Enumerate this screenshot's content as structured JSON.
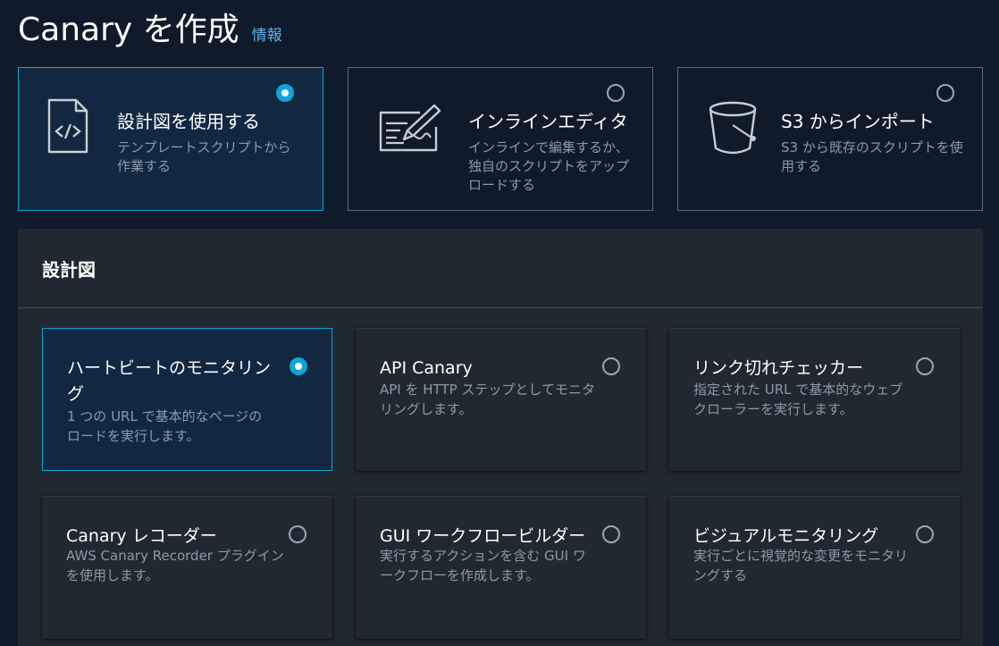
{
  "page": {
    "title": "Canary を作成",
    "info_link": "情報"
  },
  "methods": [
    {
      "title": "設計図を使用する",
      "desc": "テンプレートスクリプトから作業する",
      "selected": true,
      "icon": "code-file-icon"
    },
    {
      "title": "インラインエディタ",
      "desc": "インラインで編集するか、独自のスクリプトをアップロードする",
      "selected": false,
      "icon": "editor-pen-icon"
    },
    {
      "title": "S3 からインポート",
      "desc": "S3 から既存のスクリプトを使用する",
      "selected": false,
      "icon": "bucket-icon"
    }
  ],
  "blueprints": {
    "heading": "設計図",
    "items": [
      {
        "title": "ハートビートのモニタリング",
        "desc": "1 つの URL で基本的なページのロードを実行します。",
        "selected": true
      },
      {
        "title": "API Canary",
        "desc": "API を HTTP ステップとしてモニタリングします。",
        "selected": false
      },
      {
        "title": "リンク切れチェッカー",
        "desc": "指定された URL で基本的なウェブクローラーを実行します。",
        "selected": false
      },
      {
        "title": "Canary レコーダー",
        "desc": "AWS Canary Recorder プラグインを使用します。",
        "selected": false
      },
      {
        "title": "GUI ワークフロービルダー",
        "desc": "実行するアクションを含む GUI ワークフローを作成します。",
        "selected": false
      },
      {
        "title": "ビジュアルモニタリング",
        "desc": "実行ごとに視覚的な変更をモニタリングする",
        "selected": false
      }
    ]
  },
  "colors": {
    "accent": "#0ea5d7",
    "background": "#0f1b2a",
    "panel": "#222831",
    "link": "#5ab4f0"
  }
}
